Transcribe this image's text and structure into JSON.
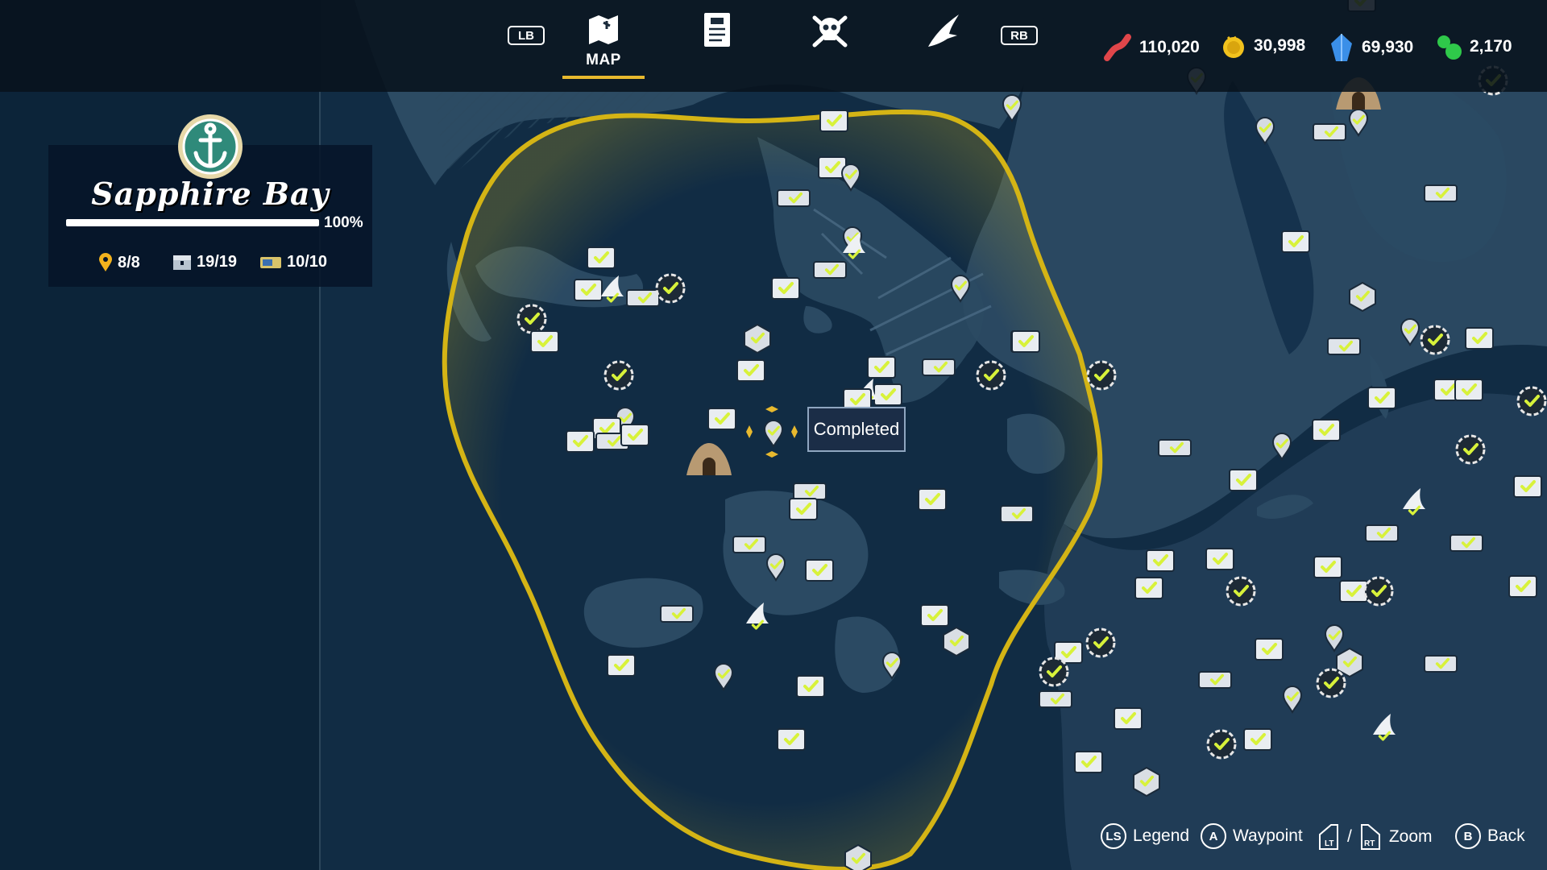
{
  "nav": {
    "left_bumper": "LB",
    "right_bumper": "RB",
    "tabs": [
      {
        "name": "map-tab",
        "icon": "map-icon",
        "label": "MAP",
        "active": true
      },
      {
        "name": "journal-tab",
        "icon": "journal-icon",
        "label": "",
        "active": false
      },
      {
        "name": "bounties-tab",
        "icon": "skull-crossbones-icon",
        "label": "",
        "active": false
      },
      {
        "name": "shark-tab",
        "icon": "shark-icon",
        "label": "",
        "active": false
      }
    ]
  },
  "currencies": [
    {
      "icon": "bait-icon",
      "value": "110,020",
      "color": "#e0464a"
    },
    {
      "icon": "gold-coin-icon",
      "value": "30,998",
      "color": "#f2c21d"
    },
    {
      "icon": "blue-crystal-icon",
      "value": "69,930",
      "color": "#3b8fe8"
    },
    {
      "icon": "green-gem-icon",
      "value": "2,170",
      "color": "#2fc94a"
    }
  ],
  "region": {
    "emblem": "anchor-emblem",
    "name": "Sapphire Bay",
    "progress_pct": 100,
    "progress_label": "100%",
    "stats": [
      {
        "icon": "location-pin-icon",
        "value": "8/8"
      },
      {
        "icon": "chest-icon",
        "value": "19/19"
      },
      {
        "icon": "ticket-icon",
        "value": "10/10"
      }
    ]
  },
  "tooltip": {
    "text": "Completed"
  },
  "controls": [
    {
      "glyph": "LS",
      "label": "Legend"
    },
    {
      "glyph": "A",
      "label": "Waypoint"
    },
    {
      "glyph": "LT",
      "label": "/"
    },
    {
      "glyph": "RT",
      "label": "Zoom"
    },
    {
      "glyph": "B",
      "label": "Back"
    }
  ],
  "colors": {
    "accent": "#e8b92e",
    "check": "#d8f23a",
    "ocean_deep": "#0b2236",
    "land": "#30506a"
  },
  "map_marker_types": [
    "chest-marker",
    "pin-marker",
    "ring-marker",
    "shield-marker",
    "ticket-marker",
    "shark-fin-marker",
    "cave-marker"
  ]
}
